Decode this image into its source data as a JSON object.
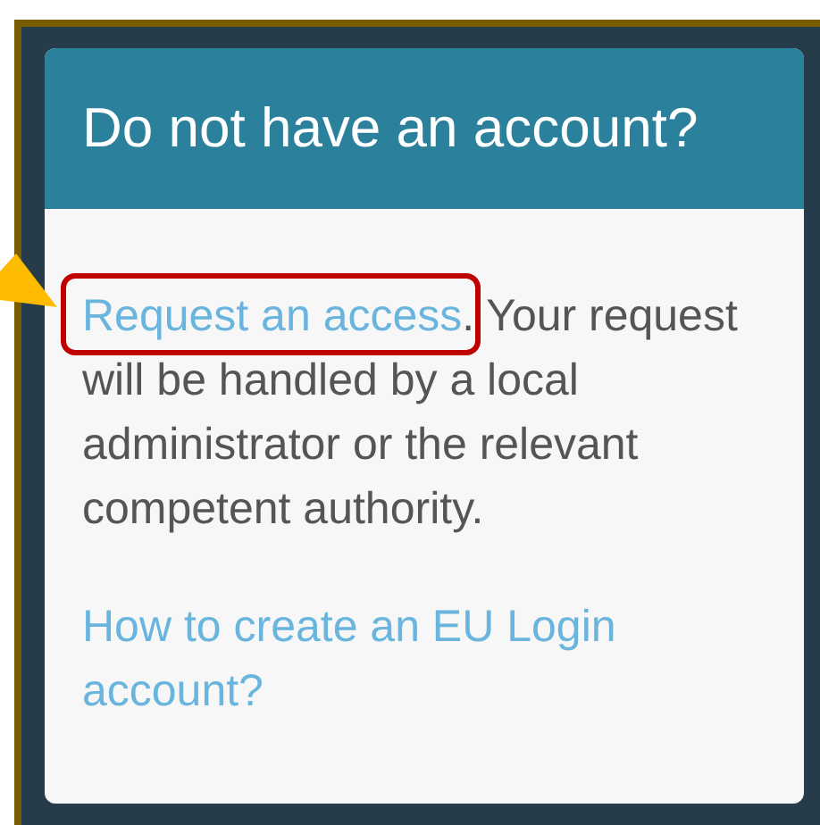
{
  "card": {
    "title": "Do not have an account?",
    "request_paragraph": {
      "link": "Request an access",
      "text": ". Your request will be handled by a local administrator or the relevant competent authority."
    },
    "help_link": "How to create an EU Login account?"
  }
}
